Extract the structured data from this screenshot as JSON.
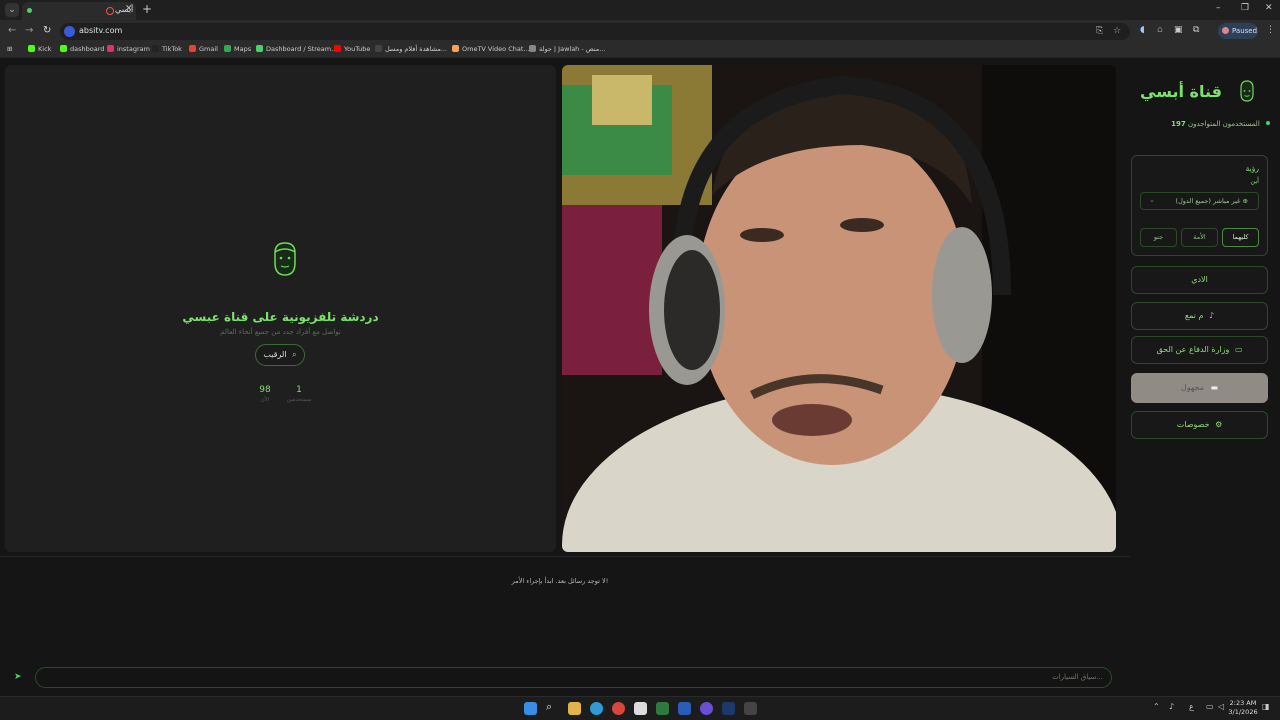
{
  "browser": {
    "tab_title": "أبسي",
    "url": "absitv.com",
    "profile_status": "Paused",
    "bookmarks": [
      {
        "label": "Kick",
        "color": "#53fc18"
      },
      {
        "label": "dashboard",
        "color": "#53fc18"
      },
      {
        "label": "instagram",
        "color": "#e1306c"
      },
      {
        "label": "TikTok",
        "color": "#222222"
      },
      {
        "label": "Gmail",
        "color": "#ea4335"
      },
      {
        "label": "Maps",
        "color": "#34a853"
      },
      {
        "label": "Dashboard / Stream...",
        "color": "#4dd06a"
      },
      {
        "label": "YouTube",
        "color": "#ff0000"
      },
      {
        "label": "مشاهدة أفلام ومسل...",
        "color": "#444444"
      },
      {
        "label": "OmeTV Video Chat...",
        "color": "#f2a15f"
      },
      {
        "label": "جولة | Jawlah - منص...",
        "color": "#888888"
      }
    ]
  },
  "left_panel": {
    "title": "دردشة تلفزيونية على قناة عبسي",
    "subtitle": "تواصل مع أفراد جدد من جميع أنحاء العالم",
    "search_button": "الرقيب",
    "stats": [
      {
        "value": "1",
        "label": "مستخدمين"
      },
      {
        "value": "98",
        "label": "الآن"
      }
    ]
  },
  "sidebar": {
    "brand": "قناة أبسي",
    "online_label": "المستخدمون المتواجدون",
    "online_count": "197",
    "filter": {
      "title": "رؤية",
      "subtitle": "أين",
      "select_value": "غير مباشر (جميع الدول)",
      "gender_options": [
        "كليهما",
        "الأمة",
        "جنو"
      ]
    },
    "buttons": [
      {
        "label": "الادي",
        "icon": ""
      },
      {
        "label": "م نمع",
        "icon": "microphone-icon"
      },
      {
        "label": "وزارة الدفاع عن الحق",
        "icon": "camera-icon"
      },
      {
        "label": "مجهول",
        "icon": "chat-icon"
      },
      {
        "label": "خصوصات",
        "icon": "gear-icon"
      }
    ]
  },
  "chat": {
    "empty_message": "لا توجد رسائل بعد. ابدأ بإجراء الأمر!",
    "input_placeholder": "سياق السيارات..."
  },
  "taskbar": {
    "time": "2:23 AM",
    "date": "3/1/2026",
    "language": "ع"
  }
}
